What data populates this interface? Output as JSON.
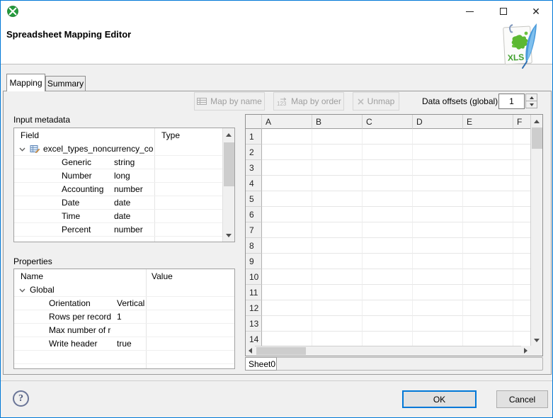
{
  "window": {
    "app_icon": "clover-logo-icon",
    "controls": {
      "minimize": "minimize",
      "maximize": "maximize",
      "close": "close"
    }
  },
  "header": {
    "title": "Spreadsheet Mapping Editor",
    "file_icon": "xls-file-icon"
  },
  "tabs": [
    {
      "label": "Mapping",
      "active": true
    },
    {
      "label": "Summary",
      "active": false
    }
  ],
  "toolbar": {
    "map_by_name_label": "Map by name",
    "map_by_order_label": "Map by order",
    "unmap_label": "Unmap",
    "data_offsets_label": "Data offsets (global)",
    "data_offsets_value": "1"
  },
  "input_metadata": {
    "label": "Input metadata",
    "columns": [
      "Field",
      "Type"
    ],
    "root": "excel_types_noncurrency_con",
    "rows": [
      {
        "field": "Generic",
        "type": "string"
      },
      {
        "field": "Number",
        "type": "long"
      },
      {
        "field": "Accounting",
        "type": "number"
      },
      {
        "field": "Date",
        "type": "date"
      },
      {
        "field": "Time",
        "type": "date"
      },
      {
        "field": "Percent",
        "type": "number"
      }
    ]
  },
  "properties": {
    "label": "Properties",
    "columns": [
      "Name",
      "Value"
    ],
    "root": "Global",
    "rows": [
      {
        "name": "Orientation",
        "value": "Vertical"
      },
      {
        "name": "Rows per record",
        "value": "1"
      },
      {
        "name": "Max number of records",
        "value": ""
      },
      {
        "name": "Write header",
        "value": "true"
      }
    ]
  },
  "grid": {
    "columns": [
      "A",
      "B",
      "C",
      "D",
      "E",
      "F"
    ],
    "rows": [
      "1",
      "2",
      "3",
      "4",
      "5",
      "6",
      "7",
      "8",
      "9",
      "10",
      "11",
      "12",
      "13",
      "14"
    ],
    "sheet_tab": "Sheet0"
  },
  "footer": {
    "help_glyph": "?",
    "ok_label": "OK",
    "cancel_label": "Cancel"
  },
  "colors": {
    "accent": "#0078d7",
    "window_bg": "#f0f0f0",
    "banner_bg": "#ffffff",
    "logo_green": "#249c3c",
    "feather_blue": "#4a9ada",
    "disabled_text": "#9e9e9e"
  }
}
